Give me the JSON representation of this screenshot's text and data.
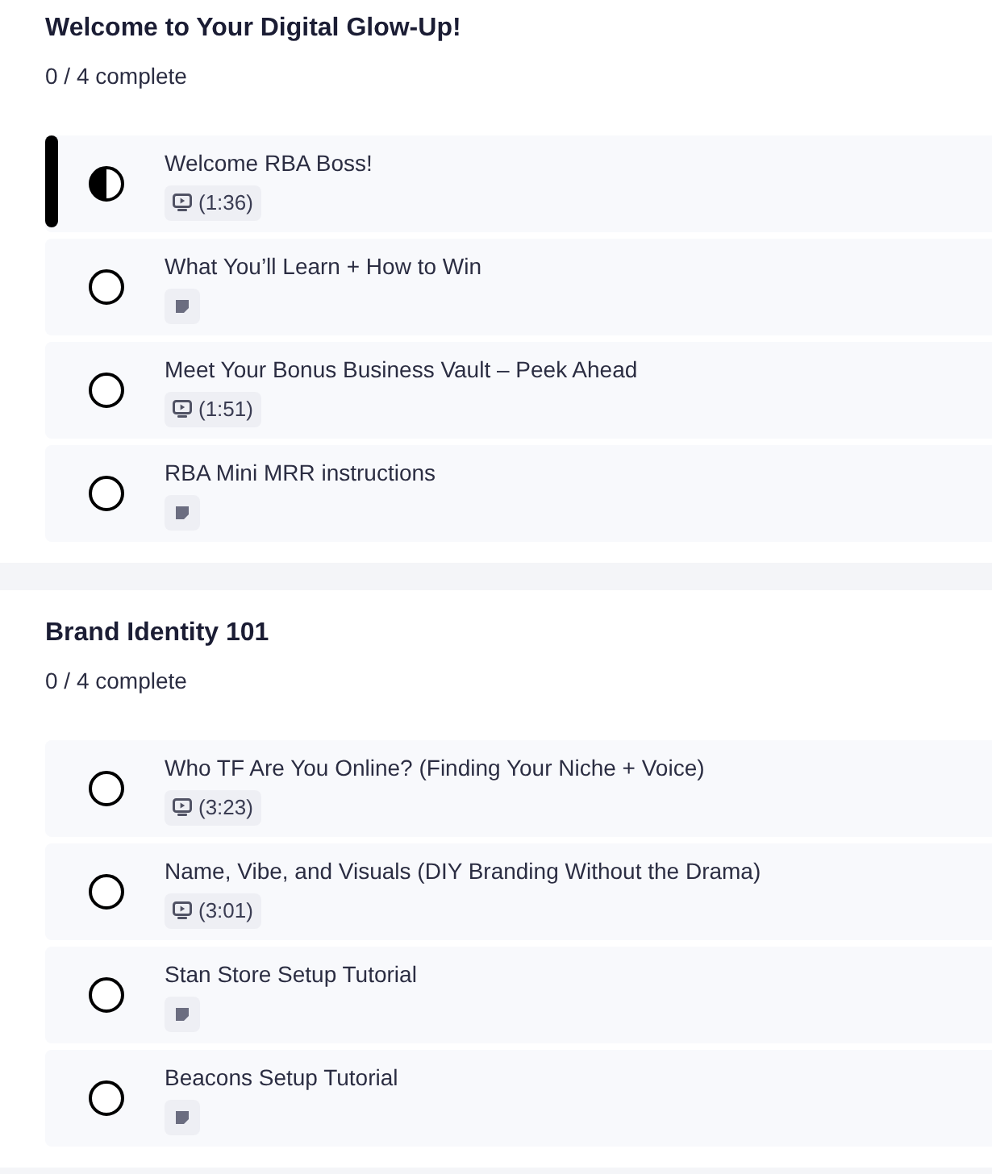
{
  "sections": [
    {
      "title": "Welcome to Your Digital Glow-Up!",
      "progress": "0 / 4 complete",
      "lessons": [
        {
          "title": "Welcome RBA Boss!",
          "started": true,
          "selected": true,
          "kind": "video",
          "duration": "(1:36)"
        },
        {
          "title": "What You’ll Learn + How to Win",
          "started": false,
          "selected": false,
          "kind": "text"
        },
        {
          "title": "Meet Your Bonus Business Vault – Peek Ahead",
          "started": false,
          "selected": false,
          "kind": "video",
          "duration": "(1:51)"
        },
        {
          "title": "RBA Mini MRR instructions",
          "started": false,
          "selected": false,
          "kind": "text"
        }
      ]
    },
    {
      "title": "Brand Identity 101",
      "progress": "0 / 4 complete",
      "lessons": [
        {
          "title": "Who TF Are You Online? (Finding Your Niche + Voice)",
          "started": false,
          "selected": false,
          "kind": "video",
          "duration": "(3:23)"
        },
        {
          "title": "Name, Vibe, and Visuals (DIY Branding Without the Drama)",
          "started": false,
          "selected": false,
          "kind": "video",
          "duration": "(3:01)"
        },
        {
          "title": "Stan Store Setup Tutorial",
          "started": false,
          "selected": false,
          "kind": "text"
        },
        {
          "title": "Beacons Setup Tutorial",
          "started": false,
          "selected": false,
          "kind": "text"
        }
      ]
    }
  ]
}
